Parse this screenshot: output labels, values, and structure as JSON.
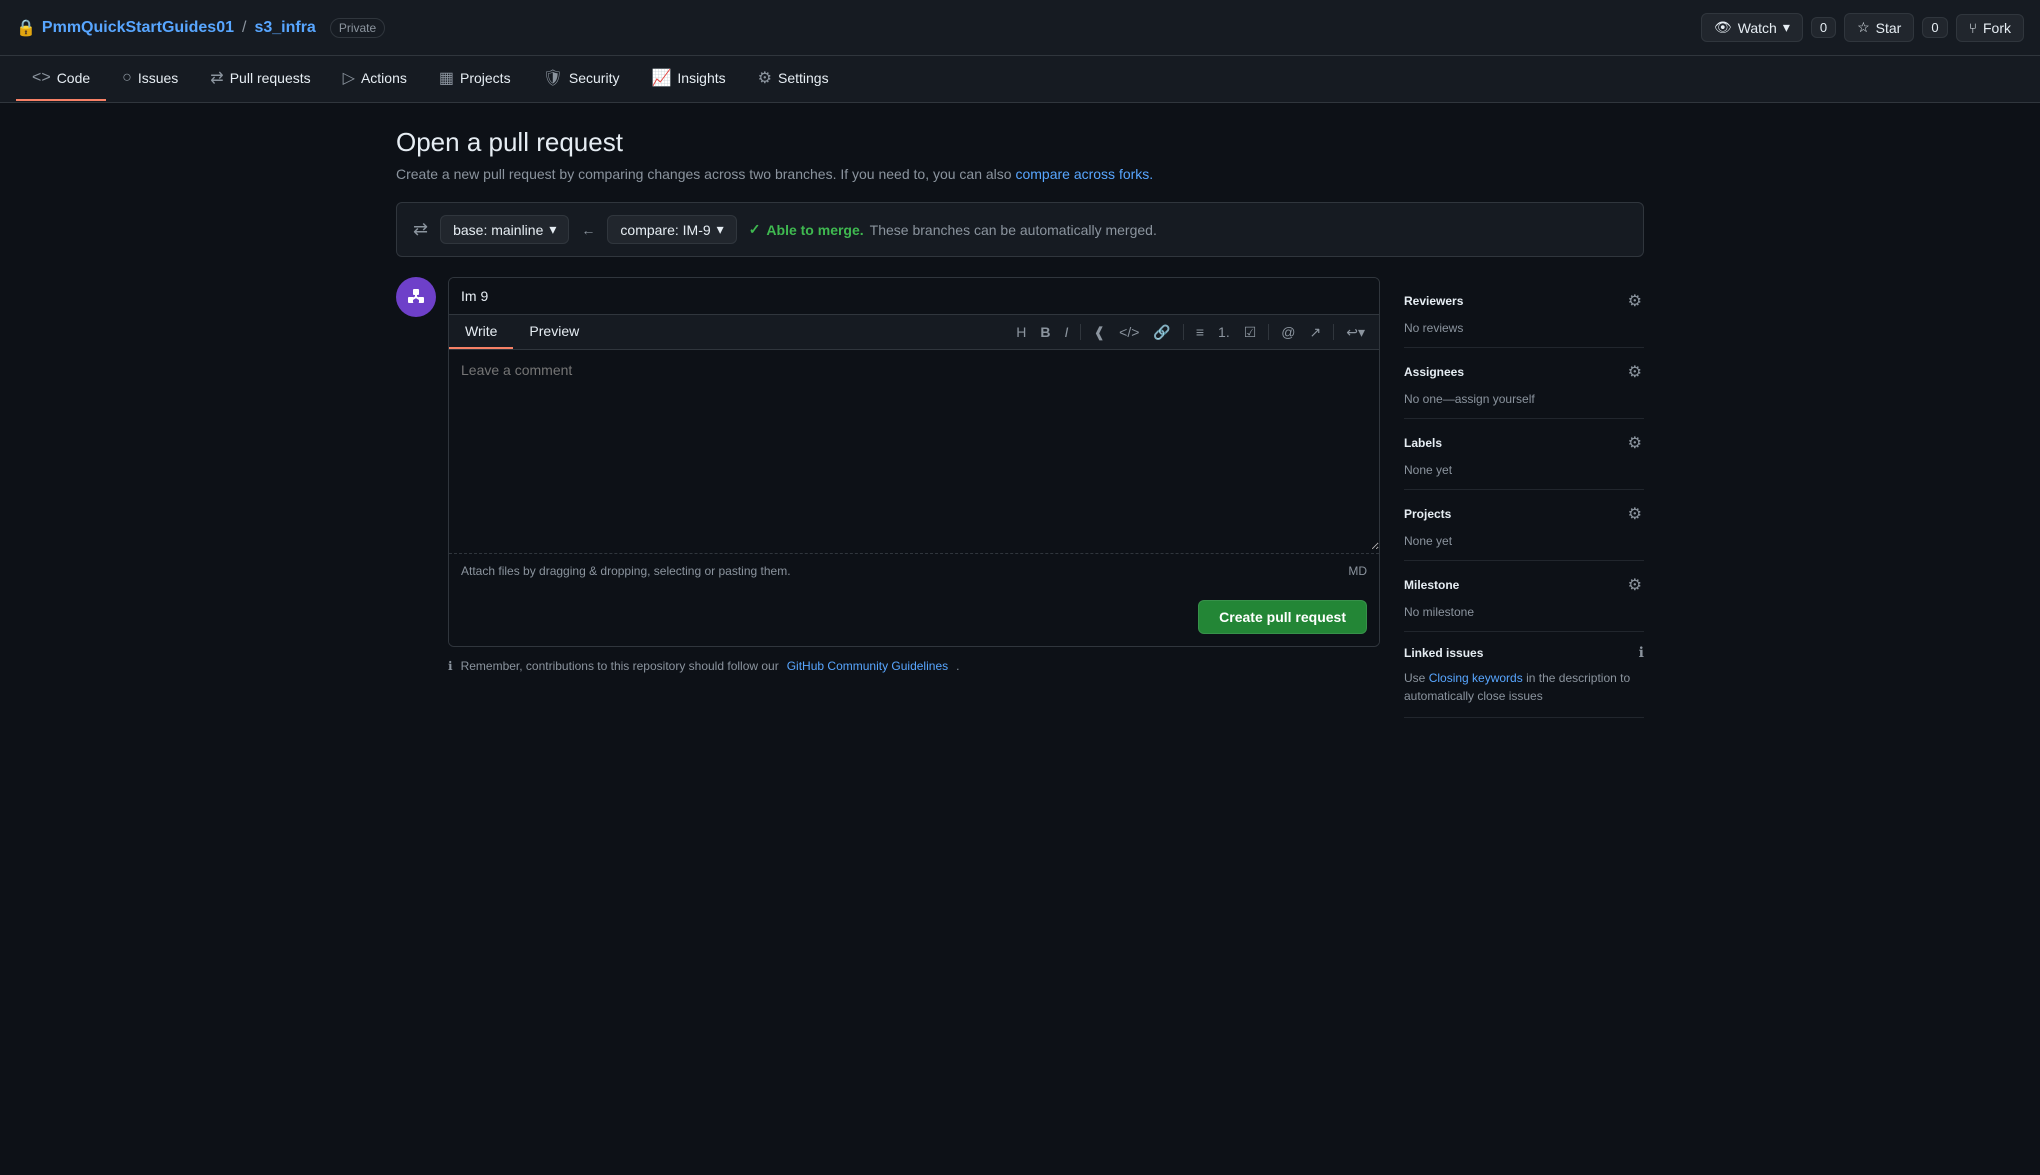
{
  "header": {
    "lock_icon": "🔒",
    "repo_owner": "PmmQuickStartGuides01",
    "repo_sep": "/",
    "repo_name": "s3_infra",
    "private_label": "Private",
    "watch_label": "Watch",
    "watch_count": "0",
    "star_label": "Star",
    "star_count": "0",
    "fork_label": "Fork"
  },
  "nav": {
    "tabs": [
      {
        "id": "code",
        "label": "Code",
        "icon": "<>",
        "active": true
      },
      {
        "id": "issues",
        "label": "Issues",
        "icon": "○"
      },
      {
        "id": "pull-requests",
        "label": "Pull requests",
        "icon": "⇄"
      },
      {
        "id": "actions",
        "label": "Actions",
        "icon": "▷"
      },
      {
        "id": "projects",
        "label": "Projects",
        "icon": "▦"
      },
      {
        "id": "security",
        "label": "Security",
        "icon": "🛡"
      },
      {
        "id": "insights",
        "label": "Insights",
        "icon": "📈"
      },
      {
        "id": "settings",
        "label": "Settings",
        "icon": "⚙"
      }
    ]
  },
  "page": {
    "title": "Open a pull request",
    "subtitle": "Create a new pull request by comparing changes across two branches. If you need to, you can also",
    "subtitle_link_text": "compare across forks.",
    "subtitle_link_href": "#"
  },
  "branch_bar": {
    "swap_icon": "⇄",
    "base_label": "base: mainline",
    "arrow": "←",
    "compare_label": "compare: IM-9",
    "check_icon": "✓",
    "merge_status_bold": "Able to merge.",
    "merge_status_text": "These branches can be automatically merged."
  },
  "pr_form": {
    "title_placeholder": "Im 9",
    "title_value": "Im 9",
    "write_tab": "Write",
    "preview_tab": "Preview",
    "toolbar": {
      "heading": "H",
      "bold": "B",
      "italic": "I",
      "quote": "≡",
      "code": "</>",
      "link": "🔗",
      "bullet_list": "≡",
      "numbered_list": "1.",
      "task_list": "☑",
      "mention": "@",
      "reference": "↗",
      "undo": "↩"
    },
    "comment_placeholder": "Leave a comment",
    "attach_text": "Attach files by dragging & dropping, selecting or pasting them.",
    "md_label": "MD",
    "create_btn": "Create pull request"
  },
  "sidebar": {
    "reviewers": {
      "title": "Reviewers",
      "value": "No reviews"
    },
    "assignees": {
      "title": "Assignees",
      "value": "No one—assign yourself"
    },
    "labels": {
      "title": "Labels",
      "value": "None yet"
    },
    "projects": {
      "title": "Projects",
      "value": "None yet"
    },
    "milestone": {
      "title": "Milestone",
      "value": "No milestone"
    },
    "linked_issues": {
      "title": "Linked issues",
      "description_prefix": "Use",
      "link_text": "Closing keywords",
      "description_suffix": "in the description to automatically close issues"
    }
  },
  "info_bar": {
    "text": "Remember, contributions to this repository should follow our",
    "link_text": "GitHub Community Guidelines",
    "link_href": "#",
    "period": "."
  }
}
